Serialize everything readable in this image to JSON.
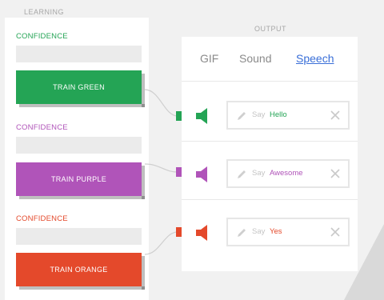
{
  "colors": {
    "green": "#24a455",
    "purple": "#b054b9",
    "orange": "#e4492b",
    "speech_link": "#3a6fd8"
  },
  "learning": {
    "title": "LEARNING",
    "classes": [
      {
        "confidence_label": "CONFIDENCE",
        "train_label": "TRAIN GREEN",
        "color": "#24a455"
      },
      {
        "confidence_label": "CONFIDENCE",
        "train_label": "TRAIN PURPLE",
        "color": "#b054b9"
      },
      {
        "confidence_label": "CONFIDENCE",
        "train_label": "TRAIN ORANGE",
        "color": "#e4492b"
      }
    ]
  },
  "output": {
    "title": "OUTPUT",
    "tabs": [
      {
        "label": "GIF"
      },
      {
        "label": "Sound"
      },
      {
        "label": "Speech",
        "active": true
      }
    ],
    "rows": [
      {
        "say_label": "Say",
        "say_value": "Hello",
        "icon": "speaker-icon",
        "color": "#24a455"
      },
      {
        "say_label": "Say",
        "say_value": "Awesome",
        "icon": "speaker-icon",
        "color": "#b054b9"
      },
      {
        "say_label": "Say",
        "say_value": "Yes",
        "icon": "speaker-icon",
        "color": "#e4492b"
      }
    ]
  }
}
